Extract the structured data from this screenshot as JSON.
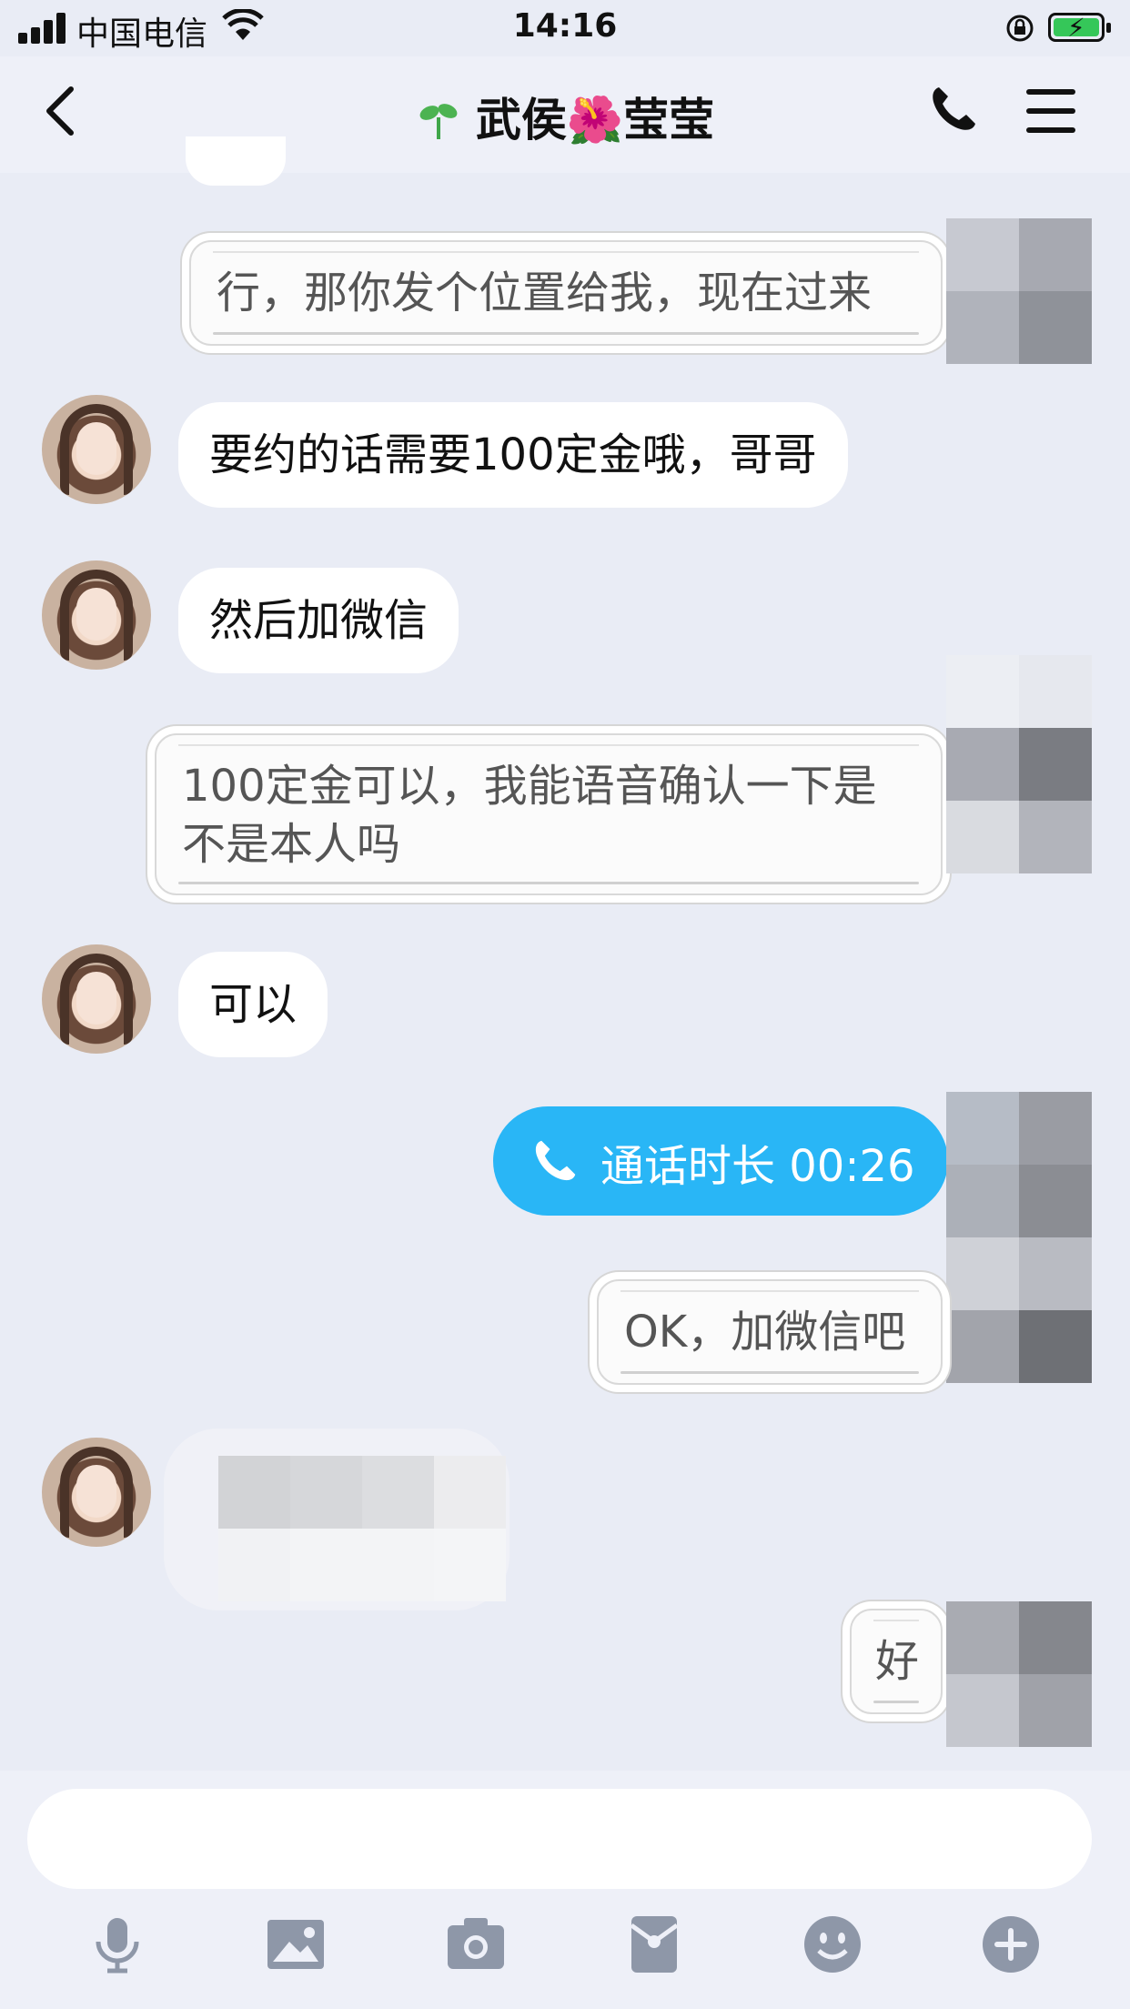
{
  "status_bar": {
    "carrier": "中国电信",
    "time": "14:16"
  },
  "nav": {
    "title": "武侯🌺莹莹",
    "title_prefix_icon": "sprout-icon"
  },
  "messages": [
    {
      "side": "out",
      "text": "行，那你发个位置给我，现在过来"
    },
    {
      "side": "in",
      "text": "要约的话需要100定金哦，哥哥"
    },
    {
      "side": "in",
      "text": "然后加微信"
    },
    {
      "side": "out",
      "text": "100定金可以，我能语音确认一下是不是本人吗"
    },
    {
      "side": "in",
      "text": "可以"
    },
    {
      "side": "out_call",
      "text": "通话时长 00:26"
    },
    {
      "side": "out",
      "text": "OK，加微信吧"
    },
    {
      "side": "in_redacted",
      "text": ""
    },
    {
      "side": "out",
      "text": "好"
    }
  ],
  "toolbar": {
    "icons": [
      "microphone-icon",
      "image-icon",
      "camera-icon",
      "red-packet-icon",
      "emoji-icon",
      "plus-icon"
    ]
  },
  "colors": {
    "background": "#e9ecf5",
    "call_bubble": "#29b6f6",
    "toolbar_icon": "#8e97a8",
    "battery": "#35c759"
  }
}
